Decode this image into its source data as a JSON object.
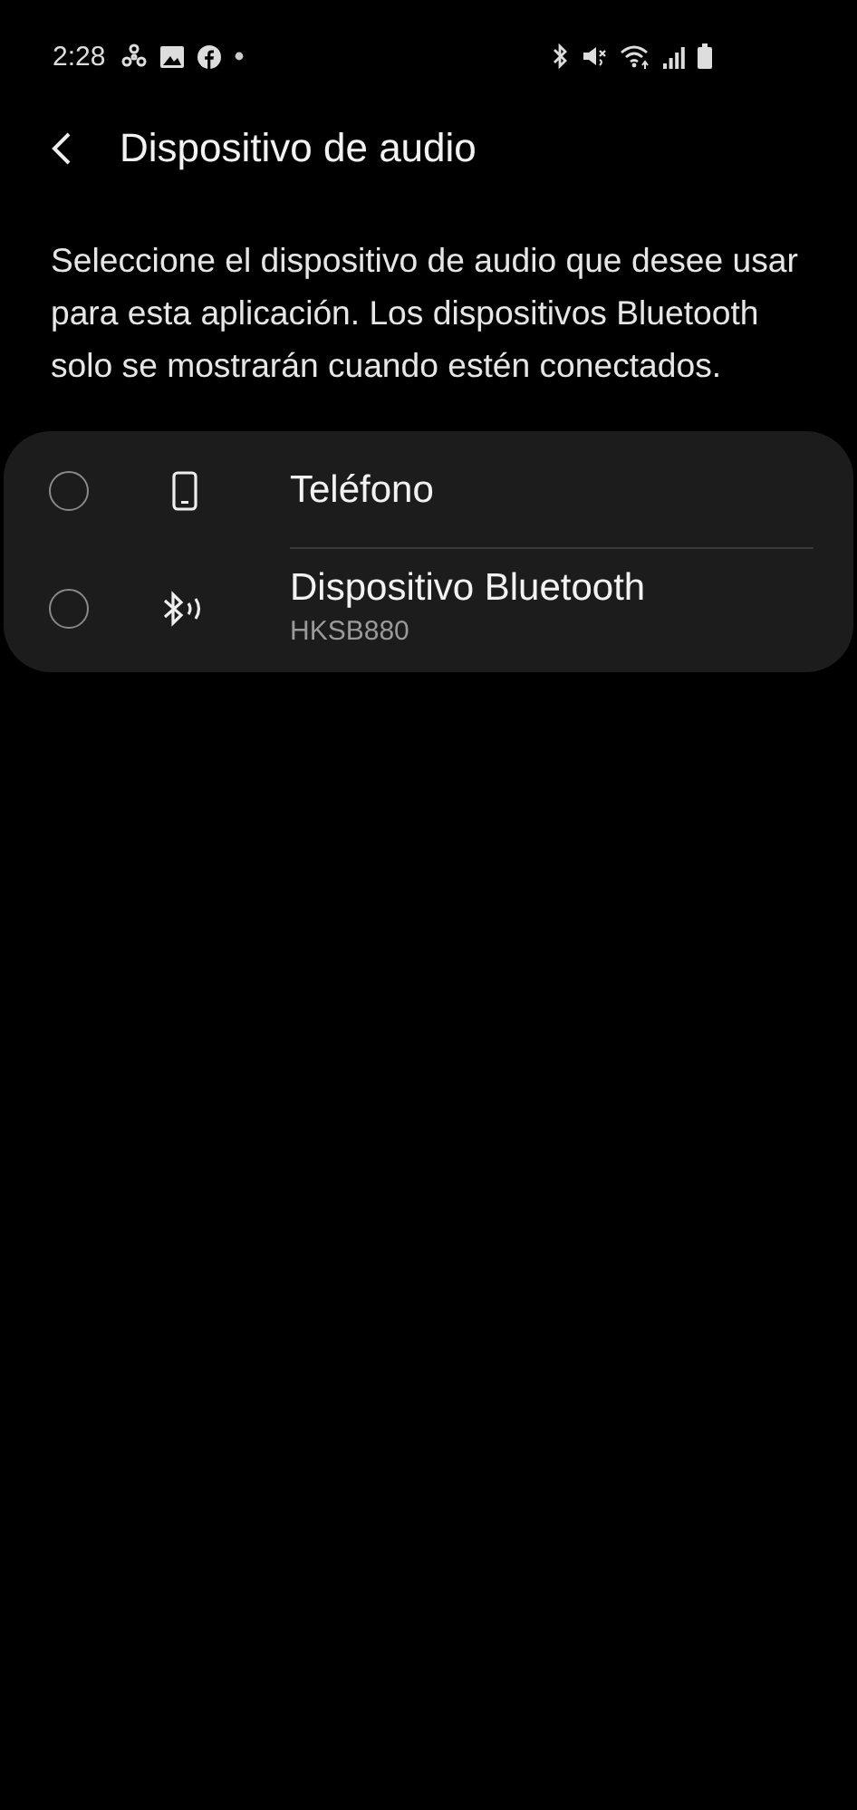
{
  "status_bar": {
    "time": "2:28"
  },
  "header": {
    "title": "Dispositivo de audio"
  },
  "description": "Seleccione el dispositivo de audio que desee usar para esta aplicación. Los dispositivos Bluetooth solo se mostrarán cuando estén conectados.",
  "options": [
    {
      "kind": "phone",
      "label": "Teléfono",
      "selected": false
    },
    {
      "kind": "bluetooth",
      "label": "Dispositivo Bluetooth",
      "subtitle": "HKSB880",
      "selected": false
    }
  ]
}
